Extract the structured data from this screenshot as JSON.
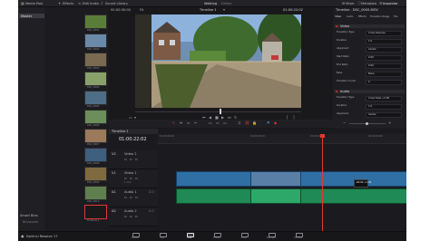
{
  "app": {
    "name": "DaVinci Resolve 17",
    "project_title": "Walking",
    "edited_label": "Edited"
  },
  "toolbar": {
    "media_pool": "Media Pool",
    "effects": "Effects",
    "edit_index": "Edit Index",
    "sound_library": "Sound Library",
    "mixer": "Mixer",
    "metadata": "Metadata",
    "inspector": "Inspector"
  },
  "bins": {
    "master": "Master",
    "smart_bins": "Smart Bins",
    "keywords": "Keywords"
  },
  "media_pool": {
    "clips": [
      {
        "name": "DSC_0001"
      },
      {
        "name": "DSC_0002"
      },
      {
        "name": "DSC_0003"
      },
      {
        "name": "DSC_0004"
      },
      {
        "name": "DSC_0005"
      },
      {
        "name": "DSC_0006"
      },
      {
        "name": "DSC_0007"
      },
      {
        "name": "DSC_0008"
      },
      {
        "name": "DSC_0009"
      },
      {
        "name": "DSC_0010"
      },
      {
        "name": "Timeline 1"
      }
    ]
  },
  "viewer": {
    "timecode_left": "00:00:00:00",
    "zoom": "Fit",
    "timeline_name": "Timeline 1",
    "timecode_right": "01:00:22:02"
  },
  "timeline": {
    "current_timecode": "01:00:22:02",
    "ruler": [
      "01:00:00:00",
      "01:00:16:00",
      "01:00:24:00",
      "01:00:32:00"
    ],
    "tracks": [
      {
        "id": "V2",
        "name": "Video 2",
        "clips": ""
      },
      {
        "id": "V1",
        "name": "Video 1",
        "clips": "1 Clip"
      },
      {
        "id": "A1",
        "name": "Audio 1",
        "level": "2.0"
      },
      {
        "id": "A2",
        "name": "Audio 2",
        "level": "2.0"
      }
    ],
    "tooltip": "-00:00\n+1:09"
  },
  "inspector": {
    "file_name": "Timeline - DSC_0045.MOV",
    "tabs": [
      "Video",
      "Audio",
      "Effects",
      "Transition",
      "Image",
      "File"
    ],
    "video_section": "Video",
    "audio_section": "Audio",
    "video_props": [
      {
        "label": "Transition Type",
        "value": "Cross Dissolve"
      },
      {
        "label": "Duration",
        "value": "1.0"
      },
      {
        "label": "Alignment",
        "value": "Center"
      },
      {
        "label": "Start Ratio",
        "value": "0.00"
      },
      {
        "label": "End Ratio",
        "value": "0.00"
      },
      {
        "label": "Ease",
        "value": "None"
      },
      {
        "label": "Transition Curve",
        "value": "0"
      }
    ],
    "audio_props": [
      {
        "label": "Transition Type",
        "value": "Cross Fade +3 dB"
      },
      {
        "label": "Duration",
        "value": "1.0"
      },
      {
        "label": "Alignment",
        "value": "Center"
      }
    ]
  },
  "pages": [
    "Media",
    "Cut",
    "Edit",
    "Fusion",
    "Color",
    "Fairlight",
    "Deliver"
  ],
  "active_page": "Edit"
}
